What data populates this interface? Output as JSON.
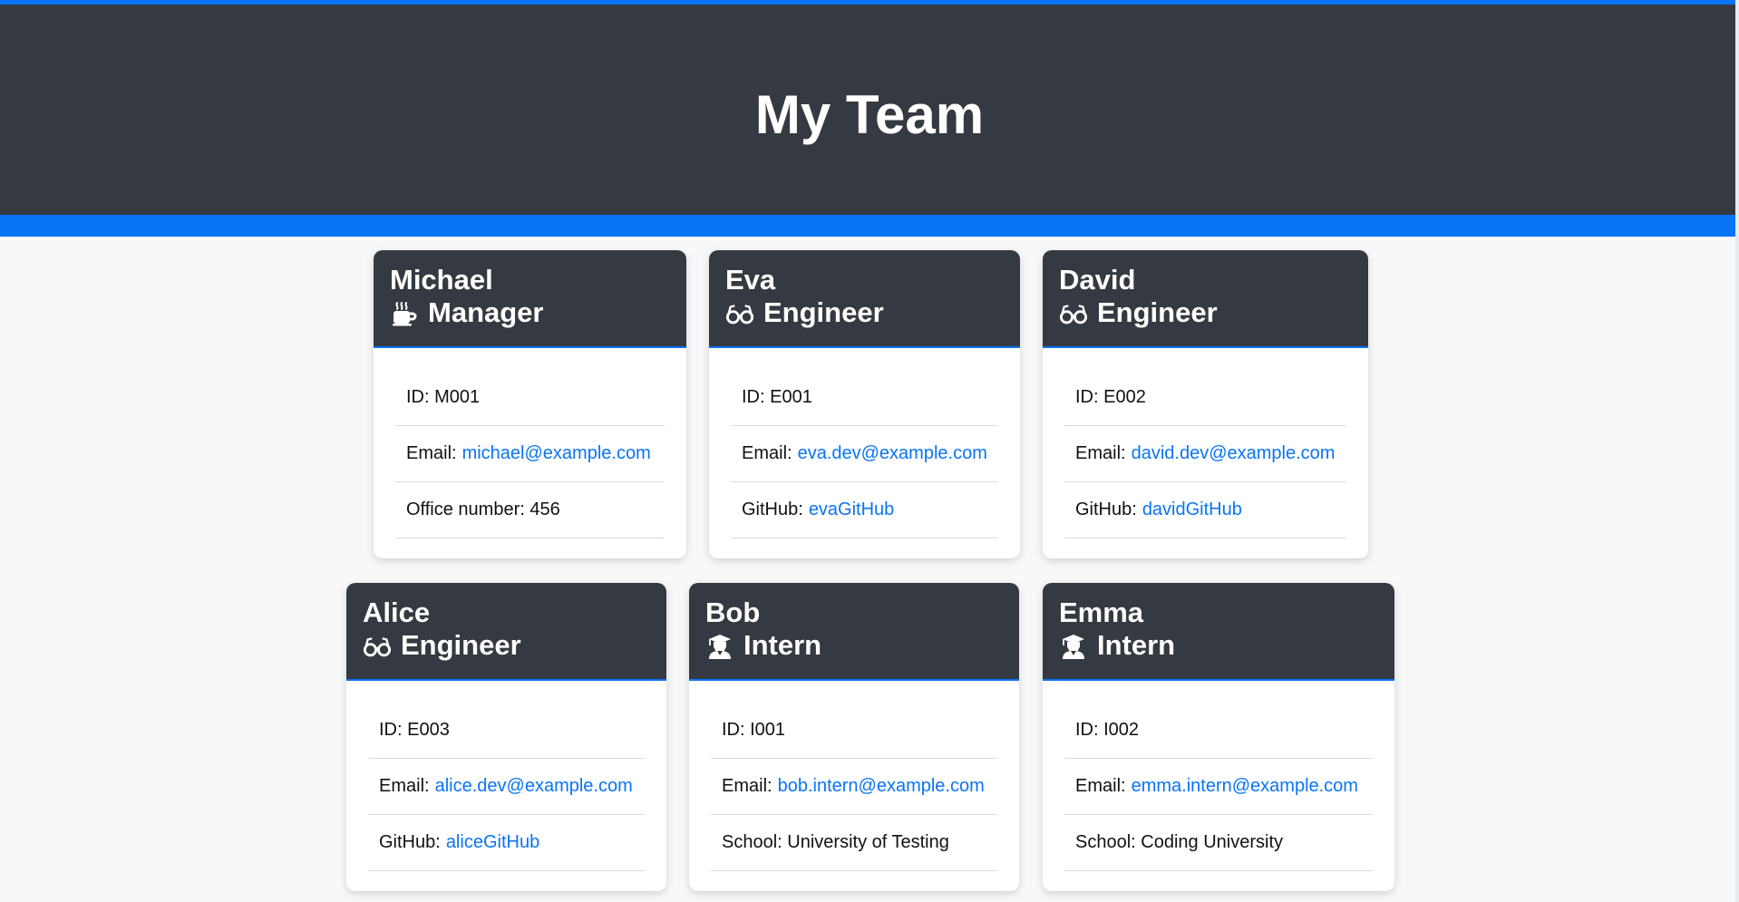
{
  "header": {
    "title": "My Team"
  },
  "colors": {
    "accent": "#0a74f7",
    "header_background": "#353a42",
    "page_background": "#f7f8f9",
    "card_background": "#ffffff"
  },
  "cards": [
    {
      "name": "Michael",
      "role": "Manager",
      "icon": "coffee-icon",
      "details": {
        "id_label": "ID:",
        "id_value": "M001",
        "email_label": "Email:",
        "email_value": "michael@example.com",
        "extra_label": "Office number:",
        "extra_value": "456"
      }
    },
    {
      "name": "Eva",
      "role": "Engineer",
      "icon": "glasses-icon",
      "details": {
        "id_label": "ID:",
        "id_value": "E001",
        "email_label": "Email:",
        "email_value": "eva.dev@example.com",
        "extra_label": "GitHub:",
        "extra_value": "evaGitHub"
      }
    },
    {
      "name": "David",
      "role": "Engineer",
      "icon": "glasses-icon",
      "details": {
        "id_label": "ID:",
        "id_value": "E002",
        "email_label": "Email:",
        "email_value": "david.dev@example.com",
        "extra_label": "GitHub:",
        "extra_value": "davidGitHub"
      }
    },
    {
      "name": "Alice",
      "role": "Engineer",
      "icon": "glasses-icon",
      "details": {
        "id_label": "ID:",
        "id_value": "E003",
        "email_label": "Email:",
        "email_value": "alice.dev@example.com",
        "extra_label": "GitHub:",
        "extra_value": "aliceGitHub"
      }
    },
    {
      "name": "Bob",
      "role": "Intern",
      "icon": "graduate-icon",
      "details": {
        "id_label": "ID:",
        "id_value": "I001",
        "email_label": "Email:",
        "email_value": "bob.intern@example.com",
        "extra_label": "School:",
        "extra_value": "University of Testing"
      }
    },
    {
      "name": "Emma",
      "role": "Intern",
      "icon": "graduate-icon",
      "details": {
        "id_label": "ID:",
        "id_value": "I002",
        "email_label": "Email:",
        "email_value": "emma.intern@example.com",
        "extra_label": "School:",
        "extra_value": "Coding University"
      }
    }
  ]
}
